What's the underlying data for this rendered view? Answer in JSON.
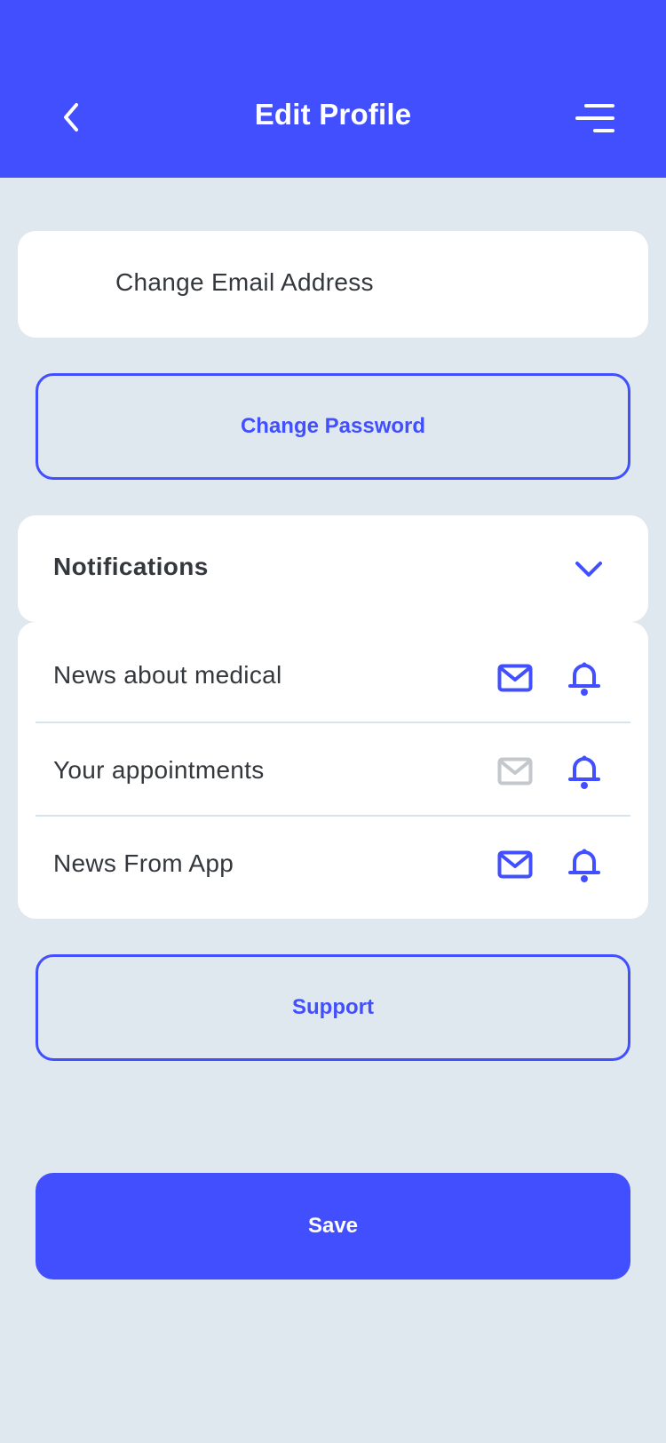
{
  "header": {
    "title": "Edit Profile",
    "back_icon": "chevron-left-icon",
    "menu_icon": "menu-icon"
  },
  "email_card": {
    "label": "Change Email Address"
  },
  "password_button": {
    "label": "Change Password"
  },
  "notifications": {
    "title": "Notifications",
    "expand_icon": "chevron-down-icon",
    "items": [
      {
        "label": "News about medical",
        "email_enabled": true,
        "push_enabled": true
      },
      {
        "label": "Your appointments",
        "email_enabled": false,
        "push_enabled": true
      },
      {
        "label": "News From App",
        "email_enabled": true,
        "push_enabled": true
      }
    ]
  },
  "support_button": {
    "label": "Support"
  },
  "save_button": {
    "label": "Save"
  },
  "colors": {
    "accent": "#424ffe",
    "background": "#dfe7ef",
    "card": "#ffffff",
    "text": "#34383d",
    "disabled_icon": "#c4c7cb"
  }
}
